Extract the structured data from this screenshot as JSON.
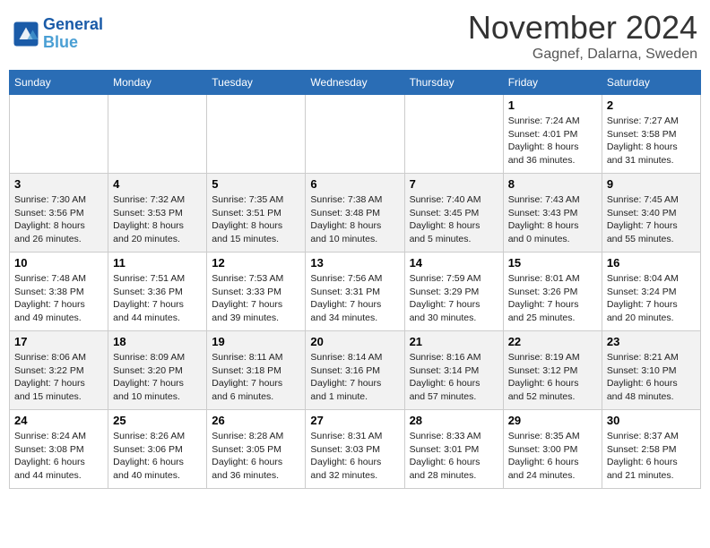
{
  "header": {
    "logo_line1": "General",
    "logo_line2": "Blue",
    "month_title": "November 2024",
    "location": "Gagnef, Dalarna, Sweden"
  },
  "days_of_week": [
    "Sunday",
    "Monday",
    "Tuesday",
    "Wednesday",
    "Thursday",
    "Friday",
    "Saturday"
  ],
  "weeks": [
    [
      {
        "day": "",
        "info": ""
      },
      {
        "day": "",
        "info": ""
      },
      {
        "day": "",
        "info": ""
      },
      {
        "day": "",
        "info": ""
      },
      {
        "day": "",
        "info": ""
      },
      {
        "day": "1",
        "info": "Sunrise: 7:24 AM\nSunset: 4:01 PM\nDaylight: 8 hours and 36 minutes."
      },
      {
        "day": "2",
        "info": "Sunrise: 7:27 AM\nSunset: 3:58 PM\nDaylight: 8 hours and 31 minutes."
      }
    ],
    [
      {
        "day": "3",
        "info": "Sunrise: 7:30 AM\nSunset: 3:56 PM\nDaylight: 8 hours and 26 minutes."
      },
      {
        "day": "4",
        "info": "Sunrise: 7:32 AM\nSunset: 3:53 PM\nDaylight: 8 hours and 20 minutes."
      },
      {
        "day": "5",
        "info": "Sunrise: 7:35 AM\nSunset: 3:51 PM\nDaylight: 8 hours and 15 minutes."
      },
      {
        "day": "6",
        "info": "Sunrise: 7:38 AM\nSunset: 3:48 PM\nDaylight: 8 hours and 10 minutes."
      },
      {
        "day": "7",
        "info": "Sunrise: 7:40 AM\nSunset: 3:45 PM\nDaylight: 8 hours and 5 minutes."
      },
      {
        "day": "8",
        "info": "Sunrise: 7:43 AM\nSunset: 3:43 PM\nDaylight: 8 hours and 0 minutes."
      },
      {
        "day": "9",
        "info": "Sunrise: 7:45 AM\nSunset: 3:40 PM\nDaylight: 7 hours and 55 minutes."
      }
    ],
    [
      {
        "day": "10",
        "info": "Sunrise: 7:48 AM\nSunset: 3:38 PM\nDaylight: 7 hours and 49 minutes."
      },
      {
        "day": "11",
        "info": "Sunrise: 7:51 AM\nSunset: 3:36 PM\nDaylight: 7 hours and 44 minutes."
      },
      {
        "day": "12",
        "info": "Sunrise: 7:53 AM\nSunset: 3:33 PM\nDaylight: 7 hours and 39 minutes."
      },
      {
        "day": "13",
        "info": "Sunrise: 7:56 AM\nSunset: 3:31 PM\nDaylight: 7 hours and 34 minutes."
      },
      {
        "day": "14",
        "info": "Sunrise: 7:59 AM\nSunset: 3:29 PM\nDaylight: 7 hours and 30 minutes."
      },
      {
        "day": "15",
        "info": "Sunrise: 8:01 AM\nSunset: 3:26 PM\nDaylight: 7 hours and 25 minutes."
      },
      {
        "day": "16",
        "info": "Sunrise: 8:04 AM\nSunset: 3:24 PM\nDaylight: 7 hours and 20 minutes."
      }
    ],
    [
      {
        "day": "17",
        "info": "Sunrise: 8:06 AM\nSunset: 3:22 PM\nDaylight: 7 hours and 15 minutes."
      },
      {
        "day": "18",
        "info": "Sunrise: 8:09 AM\nSunset: 3:20 PM\nDaylight: 7 hours and 10 minutes."
      },
      {
        "day": "19",
        "info": "Sunrise: 8:11 AM\nSunset: 3:18 PM\nDaylight: 7 hours and 6 minutes."
      },
      {
        "day": "20",
        "info": "Sunrise: 8:14 AM\nSunset: 3:16 PM\nDaylight: 7 hours and 1 minute."
      },
      {
        "day": "21",
        "info": "Sunrise: 8:16 AM\nSunset: 3:14 PM\nDaylight: 6 hours and 57 minutes."
      },
      {
        "day": "22",
        "info": "Sunrise: 8:19 AM\nSunset: 3:12 PM\nDaylight: 6 hours and 52 minutes."
      },
      {
        "day": "23",
        "info": "Sunrise: 8:21 AM\nSunset: 3:10 PM\nDaylight: 6 hours and 48 minutes."
      }
    ],
    [
      {
        "day": "24",
        "info": "Sunrise: 8:24 AM\nSunset: 3:08 PM\nDaylight: 6 hours and 44 minutes."
      },
      {
        "day": "25",
        "info": "Sunrise: 8:26 AM\nSunset: 3:06 PM\nDaylight: 6 hours and 40 minutes."
      },
      {
        "day": "26",
        "info": "Sunrise: 8:28 AM\nSunset: 3:05 PM\nDaylight: 6 hours and 36 minutes."
      },
      {
        "day": "27",
        "info": "Sunrise: 8:31 AM\nSunset: 3:03 PM\nDaylight: 6 hours and 32 minutes."
      },
      {
        "day": "28",
        "info": "Sunrise: 8:33 AM\nSunset: 3:01 PM\nDaylight: 6 hours and 28 minutes."
      },
      {
        "day": "29",
        "info": "Sunrise: 8:35 AM\nSunset: 3:00 PM\nDaylight: 6 hours and 24 minutes."
      },
      {
        "day": "30",
        "info": "Sunrise: 8:37 AM\nSunset: 2:58 PM\nDaylight: 6 hours and 21 minutes."
      }
    ]
  ]
}
